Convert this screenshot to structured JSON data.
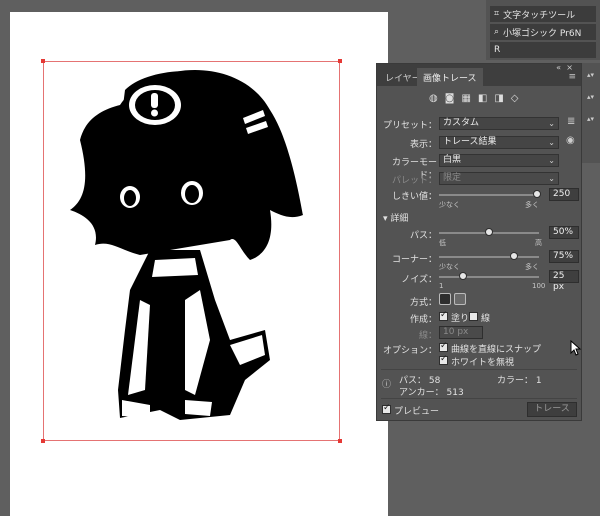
{
  "tool_panel": {
    "item1": "文字タッチツール",
    "item2": "小塚ゴシック Pr6N",
    "item3": "R"
  },
  "panel": {
    "tabs": [
      "レイヤー",
      "画像トレース"
    ],
    "preset_label": "プリセット：",
    "preset_value": "カスタム",
    "view_label": "表示：",
    "view_value": "トレース結果",
    "mode_label": "カラーモード：",
    "mode_value": "白黒",
    "palette_label": "パレット：",
    "palette_value": "限定",
    "threshold_label": "しきい値：",
    "threshold_value": "250",
    "threshold_fraction": 0.98,
    "threshold_min": "少なく",
    "threshold_max": "多く",
    "details_label": "詳細",
    "path_label": "パス：",
    "path_value": "50%",
    "path_fraction": 0.5,
    "path_min": "低",
    "path_max": "高",
    "corner_label": "コーナー：",
    "corner_value": "75%",
    "corner_fraction": 0.75,
    "corner_min": "少なく",
    "corner_max": "多く",
    "noise_label": "ノイズ：",
    "noise_value": "25 px",
    "noise_fraction": 0.24,
    "noise_min": "1",
    "noise_max": "100",
    "method_label": "方式：",
    "create_label": "作成：",
    "fill_label": "塗り",
    "stroke_label": "線",
    "stroke_width_label": "線：",
    "stroke_width_value": "10 px",
    "options_label": "オプション：",
    "snap_label": "曲線を直線にスナップ",
    "ignore_white_label": "ホワイトを無視",
    "stats_path_label": "パス：",
    "stats_path_value": "58",
    "stats_color_label": "カラー：",
    "stats_color_value": "1",
    "stats_anchor_label": "アンカー：",
    "stats_anchor_value": "513",
    "preview_label": "プレビュー",
    "trace_button": "トレース"
  },
  "colors": {
    "canvas_bg": "#5f5f5f",
    "artboard": "#ffffff",
    "selection": "#e57373",
    "panel_bg": "#535353"
  }
}
